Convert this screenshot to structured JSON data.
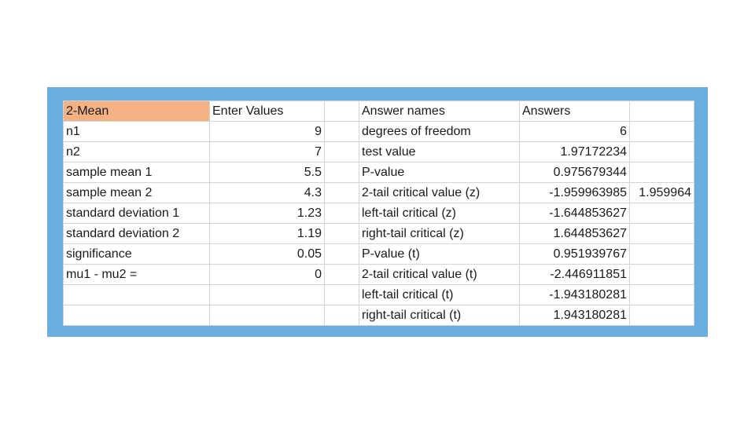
{
  "header": {
    "col1": "2-Mean",
    "col2": "Enter Values",
    "col4": "Answer names",
    "col5": "Answers"
  },
  "colors": {
    "panel_background": "#6aaee0",
    "highlight_cell": "#f4b183",
    "grid_line": "#d4d4d4"
  },
  "rows": [
    {
      "input_name": "n1",
      "input_value": "9",
      "answer_name": "degrees of freedom",
      "answer_value": "6",
      "extra": ""
    },
    {
      "input_name": "n2",
      "input_value": "7",
      "answer_name": "test value",
      "answer_value": "1.97172234",
      "extra": ""
    },
    {
      "input_name": "sample mean 1",
      "input_value": "5.5",
      "answer_name": "P-value",
      "answer_value": "0.975679344",
      "extra": ""
    },
    {
      "input_name": "sample mean 2",
      "input_value": "4.3",
      "answer_name": "2-tail critical value (z)",
      "answer_value": "-1.959963985",
      "extra": "1.959964"
    },
    {
      "input_name": "standard deviation 1",
      "input_value": "1.23",
      "answer_name": "left-tail critical (z)",
      "answer_value": "-1.644853627",
      "extra": ""
    },
    {
      "input_name": "standard deviation 2",
      "input_value": "1.19",
      "answer_name": "right-tail critical (z)",
      "answer_value": "1.644853627",
      "extra": ""
    },
    {
      "input_name": "significance",
      "input_value": "0.05",
      "answer_name": "P-value (t)",
      "answer_value": "0.951939767",
      "extra": ""
    },
    {
      "input_name": "mu1 - mu2 =",
      "input_value": "0",
      "answer_name": "2-tail critical value (t)",
      "answer_value": "-2.446911851",
      "extra": ""
    },
    {
      "input_name": "",
      "input_value": "",
      "answer_name": "left-tail critical (t)",
      "answer_value": "-1.943180281",
      "extra": ""
    },
    {
      "input_name": "",
      "input_value": "",
      "answer_name": "right-tail critical (t)",
      "answer_value": "1.943180281",
      "extra": ""
    }
  ]
}
